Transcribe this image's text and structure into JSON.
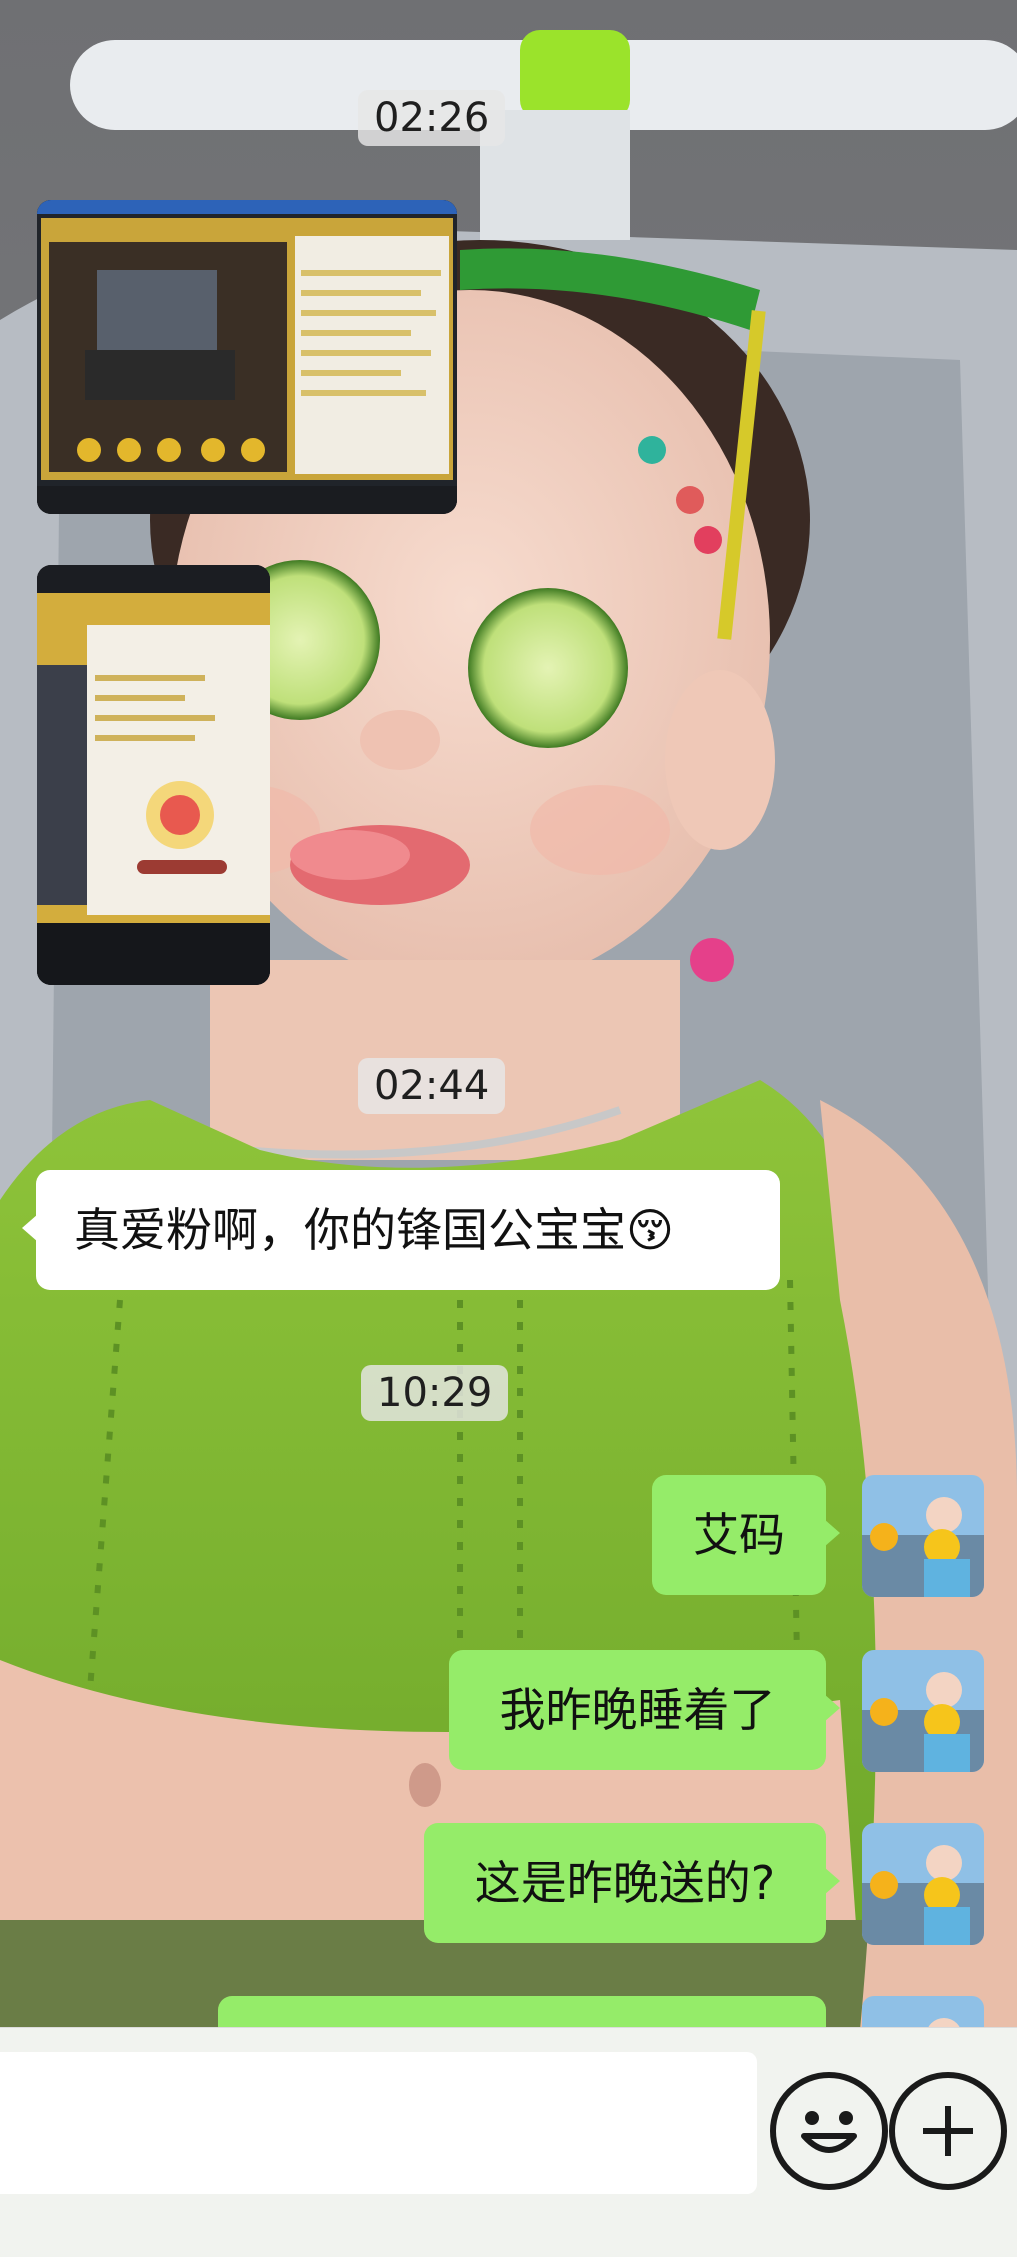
{
  "timestamps": [
    "02:26",
    "02:44",
    "10:29"
  ],
  "image_messages": [
    {
      "icon": "screenshot-image-livestream"
    },
    {
      "icon": "screenshot-image-livestream-rank"
    }
  ],
  "incoming_messages": [
    {
      "text": "真爱粉啊，你的锋国公宝宝",
      "emoji": "😚"
    }
  ],
  "outgoing_messages": [
    {
      "text": "艾码"
    },
    {
      "text": "我昨晚睡着了"
    },
    {
      "text": "这是昨晚送的?"
    },
    {
      "text": ""
    }
  ],
  "input_bar": {
    "placeholder": "",
    "emoji_icon": "smiley-face-icon",
    "plus_icon": "plus-circle-icon"
  },
  "colors": {
    "outgoing_bubble": "#95ec69",
    "incoming_bubble": "#ffffff",
    "input_bar_bg": "#f1f3ef"
  }
}
